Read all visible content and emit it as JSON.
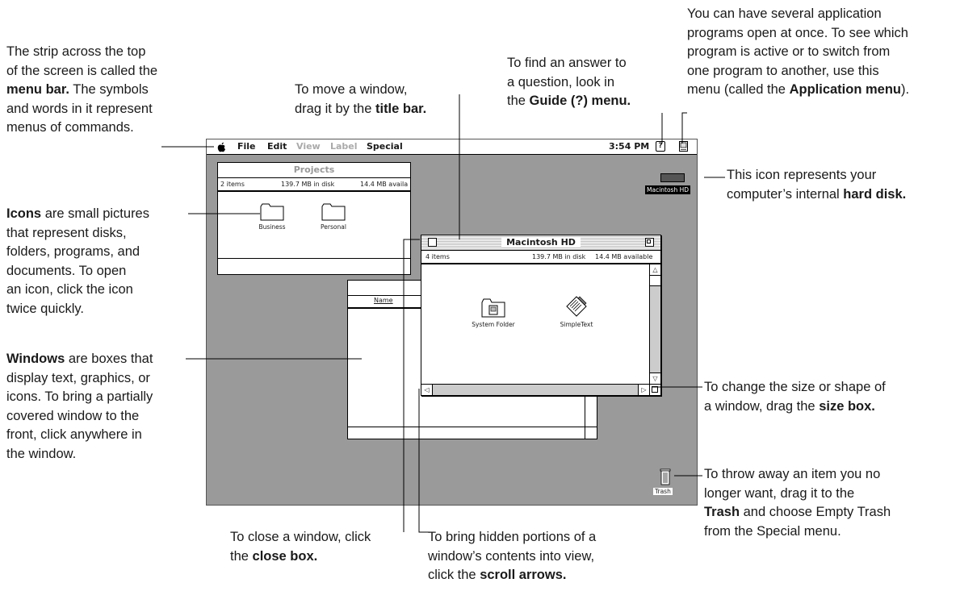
{
  "callouts": {
    "menu_bar": {
      "line1": "The strip across the top",
      "line2": "of the screen is called the",
      "line3_bold": "menu bar.",
      "line3_rest": " The symbols",
      "line4": "and words in it represent",
      "line5": "menus of commands."
    },
    "title_bar": {
      "line1": "To move a window,",
      "line2_pre": "drag it by the ",
      "line2_bold": "title bar."
    },
    "guide": {
      "line1": "To find an answer to",
      "line2": "a question, look in",
      "line3_pre": "the ",
      "line3_bold": "Guide (?) menu."
    },
    "application": {
      "line1": "You can have several application",
      "line2": "programs open at once. To see which",
      "line3": "program is active or to switch from",
      "line4": "one program to another, use this",
      "line5_pre": "menu (called the ",
      "line5_bold": "Application menu",
      "line5_post": ")."
    },
    "hard_disk": {
      "line1": "This icon represents your",
      "line2_pre": "computer’s internal ",
      "line2_bold": "hard disk."
    },
    "icons": {
      "line1_bold": "Icons",
      "line1_rest": " are small pictures",
      "line2": "that represent disks,",
      "line3": "folders, programs, and",
      "line4": "documents. To open",
      "line5": "an icon, click the icon",
      "line6": "twice quickly."
    },
    "windows": {
      "line1_bold": "Windows",
      "line1_rest": " are boxes that",
      "line2": "display text, graphics, or",
      "line3": "icons. To bring a partially",
      "line4": "covered window to the",
      "line5": "front, click anywhere in",
      "line6": "the window."
    },
    "size_box": {
      "line1": "To change the size or shape of",
      "line2_pre": "a window, drag the ",
      "line2_bold": "size box."
    },
    "trash": {
      "line1": "To throw away an item you no",
      "line2": "longer want, drag it to the",
      "line3_bold": "Trash",
      "line3_rest": " and choose Empty Trash",
      "line4": "from the Special menu."
    },
    "close_box": {
      "line1": "To close a window, click",
      "line2_pre": "the ",
      "line2_bold": "close box."
    },
    "scroll_arrows": {
      "line1": "To bring hidden portions of a",
      "line2": "window’s contents into view,",
      "line3_pre": "click the ",
      "line3_bold": "scroll arrows."
    }
  },
  "menubar": {
    "apple": "",
    "file": "File",
    "edit": "Edit",
    "view": "View",
    "label": "Label",
    "special": "Special",
    "clock": "3:54 PM",
    "guide_glyph": "?"
  },
  "desktop": {
    "hd_label": "Macintosh HD",
    "trash_label": "Trash"
  },
  "projects_window": {
    "title": "Projects",
    "items": "2 items",
    "disk": "139.7 MB in disk",
    "available": "14.4 MB availa",
    "icons": [
      "Business",
      "Personal"
    ]
  },
  "name_window": {
    "column_header": "Name"
  },
  "hd_window": {
    "title": "Macintosh HD",
    "items": "4 items",
    "disk": "139.7 MB in disk",
    "available": "14.4 MB available",
    "icons": [
      "System Folder",
      "SimpleText"
    ]
  },
  "colors": {
    "desktop": "#9a9a9a",
    "text": "#1a1a1a"
  }
}
